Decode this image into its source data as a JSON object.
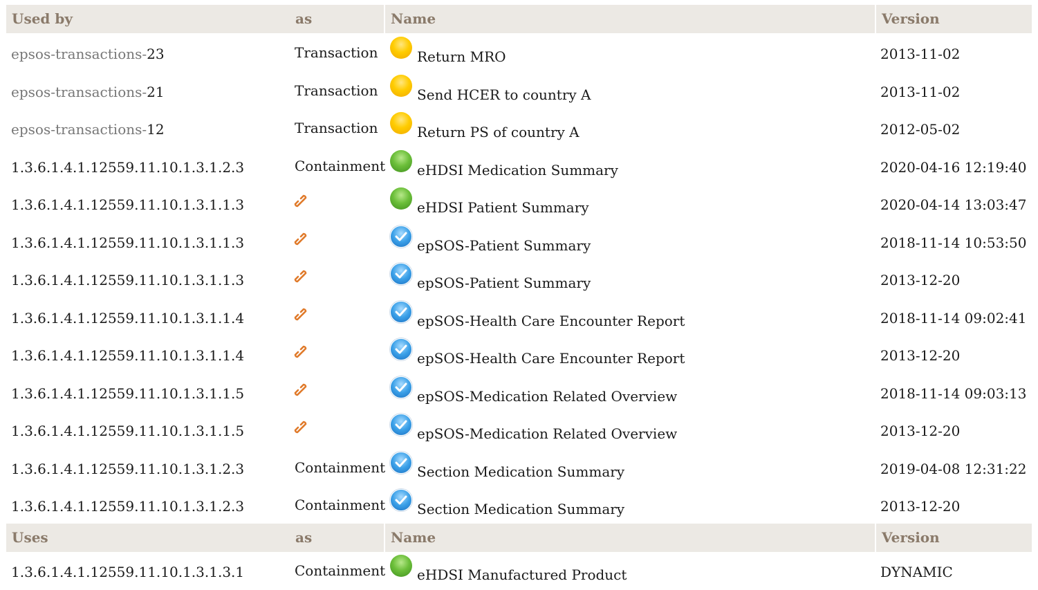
{
  "used_by_header": {
    "col1": "Used by",
    "col2": "as",
    "col3": "Name",
    "col4": "Version"
  },
  "used_by_rows": [
    {
      "id_prefix": "epsos-transactions-",
      "id_suffix": "23",
      "as": "Transaction",
      "icon": "status-yellow-icon",
      "name": "Return MRO",
      "version": "2013-11-02"
    },
    {
      "id_prefix": "epsos-transactions-",
      "id_suffix": "21",
      "as": "Transaction",
      "icon": "status-yellow-icon",
      "name": "Send HCER to country A",
      "version": "2013-11-02"
    },
    {
      "id_prefix": "epsos-transactions-",
      "id_suffix": "12",
      "as": "Transaction",
      "icon": "status-yellow-icon",
      "name": "Return PS of country A",
      "version": "2012-05-02"
    },
    {
      "id_prefix": "",
      "id_suffix": "1.3.6.1.4.1.12559.11.10.1.3.1.2.3",
      "as": "Containment",
      "icon": "status-green-icon",
      "name": "eHDSI Medication Summary",
      "version": "2020-04-16 12:19:40"
    },
    {
      "id_prefix": "",
      "id_suffix": "1.3.6.1.4.1.12559.11.10.1.3.1.1.3",
      "as": "",
      "icon": "status-green-icon",
      "name": "eHDSI Patient Summary",
      "version": "2020-04-14 13:03:47"
    },
    {
      "id_prefix": "",
      "id_suffix": "1.3.6.1.4.1.12559.11.10.1.3.1.1.3",
      "as": "",
      "icon": "status-blue-check-icon",
      "name": "epSOS-Patient Summary",
      "version": "2018-11-14 10:53:50"
    },
    {
      "id_prefix": "",
      "id_suffix": "1.3.6.1.4.1.12559.11.10.1.3.1.1.3",
      "as": "",
      "icon": "status-blue-check-icon",
      "name": "epSOS-Patient Summary",
      "version": "2013-12-20"
    },
    {
      "id_prefix": "",
      "id_suffix": "1.3.6.1.4.1.12559.11.10.1.3.1.1.4",
      "as": "",
      "icon": "status-blue-check-icon",
      "name": "epSOS-Health Care Encounter Report",
      "version": "2018-11-14 09:02:41"
    },
    {
      "id_prefix": "",
      "id_suffix": "1.3.6.1.4.1.12559.11.10.1.3.1.1.4",
      "as": "",
      "icon": "status-blue-check-icon",
      "name": "epSOS-Health Care Encounter Report",
      "version": "2013-12-20"
    },
    {
      "id_prefix": "",
      "id_suffix": "1.3.6.1.4.1.12559.11.10.1.3.1.1.5",
      "as": "",
      "icon": "status-blue-check-icon",
      "name": "epSOS-Medication Related Overview",
      "version": "2018-11-14 09:03:13"
    },
    {
      "id_prefix": "",
      "id_suffix": "1.3.6.1.4.1.12559.11.10.1.3.1.1.5",
      "as": "",
      "icon": "status-blue-check-icon",
      "name": "epSOS-Medication Related Overview",
      "version": "2013-12-20"
    },
    {
      "id_prefix": "",
      "id_suffix": "1.3.6.1.4.1.12559.11.10.1.3.1.2.3",
      "as": "Containment",
      "icon": "status-blue-check-icon",
      "name": "Section Medication Summary",
      "version": "2019-04-08 12:31:22"
    },
    {
      "id_prefix": "",
      "id_suffix": "1.3.6.1.4.1.12559.11.10.1.3.1.2.3",
      "as": "Containment",
      "icon": "status-blue-check-icon",
      "name": "Section Medication Summary",
      "version": "2013-12-20"
    }
  ],
  "uses_header": {
    "col1": "Uses",
    "col2": "as",
    "col3": "Name",
    "col4": "Version"
  },
  "uses_rows": [
    {
      "id_prefix": "",
      "id_suffix": "1.3.6.1.4.1.12559.11.10.1.3.1.3.1",
      "as": "Containment",
      "icon": "status-green-icon",
      "name": "eHDSI Manufactured Product",
      "version": "DYNAMIC"
    }
  ],
  "colors": {
    "header_bg": "#ece9e4",
    "header_text": "#8a7a6a",
    "muted_link": "#777777",
    "link_icon": "#e07a2a"
  }
}
